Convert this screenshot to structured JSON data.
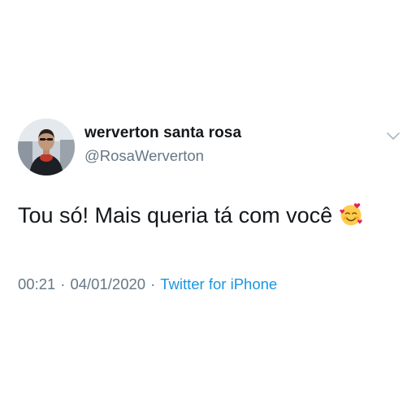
{
  "user": {
    "display_name": "werverton santa rosa",
    "handle": "@RosaWerverton"
  },
  "tweet": {
    "text": "Tou só! Mais queria tá com você",
    "emoji": "smiling-face-with-hearts"
  },
  "meta": {
    "time": "00:21",
    "separator": "·",
    "date": "04/01/2020",
    "source": "Twitter for iPhone"
  },
  "colors": {
    "text_primary": "#14171a",
    "text_secondary": "#657786",
    "link": "#1b95e0",
    "background": "#ffffff"
  },
  "icons": {
    "menu": "chevron-down-icon"
  }
}
